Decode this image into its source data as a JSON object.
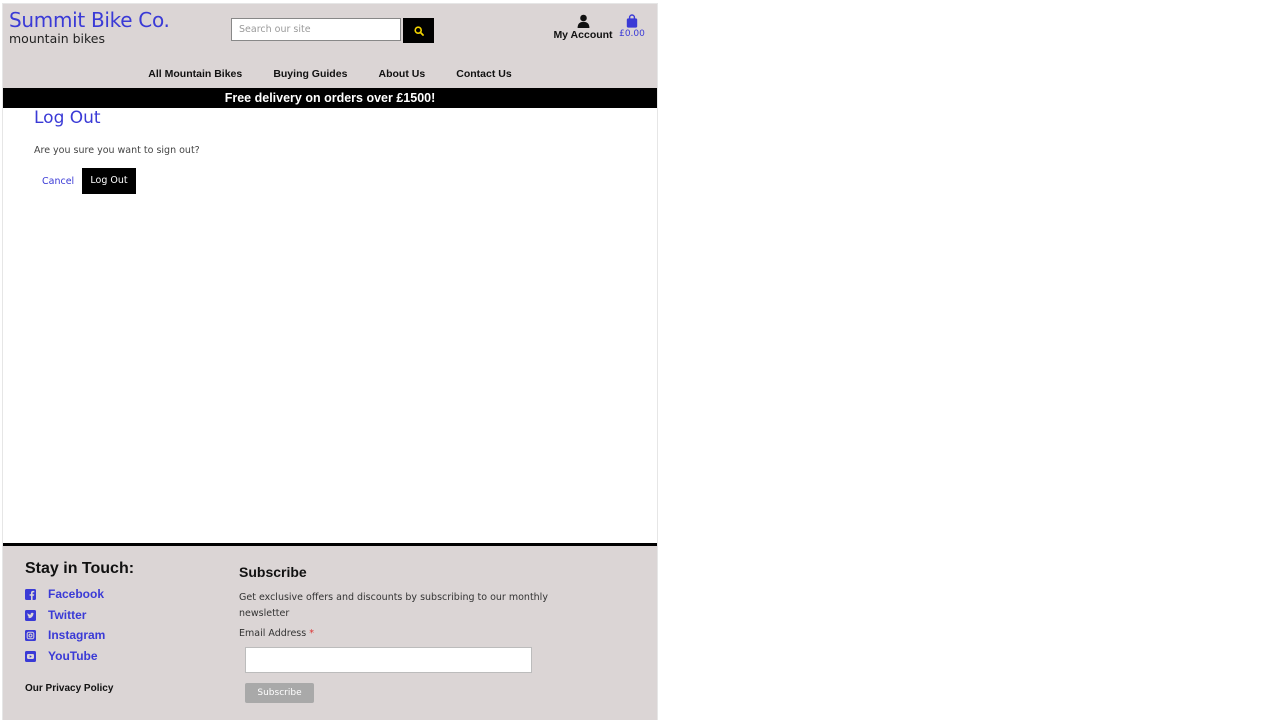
{
  "header": {
    "logo_title": "Summit Bike Co.",
    "logo_subtitle": "mountain bikes",
    "search": {
      "placeholder": "Search our site",
      "value": ""
    },
    "account_label": "My Account",
    "bag_total": "£0.00",
    "icons": {
      "search": "search-icon",
      "account": "user-icon",
      "bag": "shopping-bag-icon"
    }
  },
  "nav": {
    "items": [
      {
        "label": "All Mountain Bikes"
      },
      {
        "label": "Buying Guides"
      },
      {
        "label": "About Us"
      },
      {
        "label": "Contact Us"
      }
    ]
  },
  "banner": {
    "text": "Free delivery on orders over £1500!"
  },
  "main": {
    "title": "Log Out",
    "confirm_text": "Are you sure you want to sign out?",
    "cancel_label": "Cancel",
    "logout_label": "Log Out"
  },
  "footer": {
    "heading": "Stay in Touch:",
    "social": [
      {
        "label": "Facebook",
        "icon": "facebook-icon"
      },
      {
        "label": "Twitter",
        "icon": "twitter-icon"
      },
      {
        "label": "Instagram",
        "icon": "instagram-icon"
      },
      {
        "label": "YouTube",
        "icon": "youtube-icon"
      }
    ],
    "privacy_label": "Our Privacy Policy",
    "subscribe": {
      "heading": "Subscribe",
      "text": "Get exclusive offers and discounts by subscribing to our monthly newsletter",
      "email_label": "Email Address",
      "required_marker": "*",
      "email_value": "",
      "button_label": "Subscribe"
    }
  },
  "colors": {
    "brand_blue": "#3a3ad6",
    "header_bg": "#dbd5d5",
    "banner_bg": "#000000",
    "accent_yellow": "#f2d300"
  }
}
